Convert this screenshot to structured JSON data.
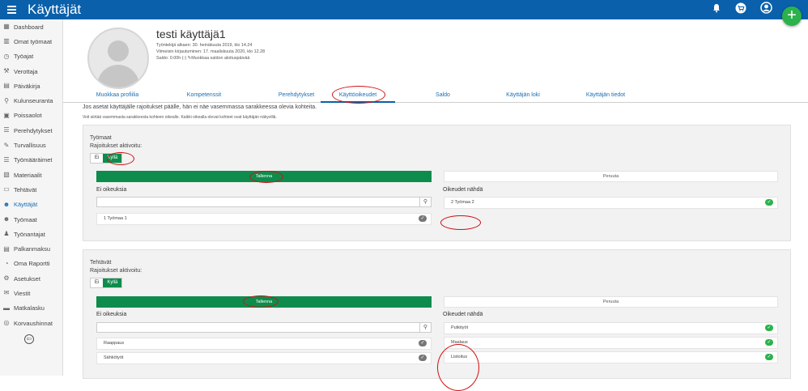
{
  "header": {
    "title": "Käyttäjät"
  },
  "sidebar": {
    "items": [
      {
        "label": "Dashboard",
        "icon": "dashboard-icon",
        "glyph": "▦"
      },
      {
        "label": "Omat työmaat",
        "icon": "building-icon",
        "glyph": "▥"
      },
      {
        "label": "Työajat",
        "icon": "clock-icon",
        "glyph": "◷"
      },
      {
        "label": "Verottaja",
        "icon": "hammer-icon",
        "glyph": "⚒"
      },
      {
        "label": "Päiväkirja",
        "icon": "book-icon",
        "glyph": "▤"
      },
      {
        "label": "Kulunseuranta",
        "icon": "location-icon",
        "glyph": "⚲"
      },
      {
        "label": "Poissaolot",
        "icon": "calendar-icon",
        "glyph": "▣"
      },
      {
        "label": "Perehdytykset",
        "icon": "list-icon",
        "glyph": "☰"
      },
      {
        "label": "Turvallisuus",
        "icon": "pencil-icon",
        "glyph": "✎"
      },
      {
        "label": "Työmääräimet",
        "icon": "list-icon",
        "glyph": "☰"
      },
      {
        "label": "Materiaalit",
        "icon": "box-icon",
        "glyph": "▧"
      },
      {
        "label": "Tehtävät",
        "icon": "document-icon",
        "glyph": "▭"
      },
      {
        "label": "Käyttäjät",
        "icon": "users-icon",
        "glyph": "☻"
      },
      {
        "label": "Työmaat",
        "icon": "user-group-icon",
        "glyph": "☻"
      },
      {
        "label": "Työnantajat",
        "icon": "person-icon",
        "glyph": "♟"
      },
      {
        "label": "Palkanmaksu",
        "icon": "sheet-icon",
        "glyph": "▤"
      },
      {
        "label": "Oma Raportti",
        "icon": "pie-chart-icon",
        "glyph": "◔"
      },
      {
        "label": "Asetukset",
        "icon": "gear-icon",
        "glyph": "⚙"
      },
      {
        "label": "Viestit",
        "icon": "mail-icon",
        "glyph": "✉"
      },
      {
        "label": "Matkalasku",
        "icon": "car-icon",
        "glyph": "▬"
      },
      {
        "label": "Korvaushinnat",
        "icon": "coins-icon",
        "glyph": "◎"
      }
    ],
    "collapse_glyph": "⇦"
  },
  "profile": {
    "name": "testi käyttäjä1",
    "worker_since": "Työntekijä alkaen: 30. heinäkuuta 2019, klo 14.24",
    "last_login": "Viimeisin kirjautuminen: 17. maaliskuuta 2020, klo 12.28",
    "balance": "Saldo: 0.00h (-)",
    "edit_balance": "Muokkaa saldon aloituspäivää"
  },
  "tabs": [
    {
      "label": "Muokkaa profiilia",
      "name": "tab-edit-profile"
    },
    {
      "label": "Kompetenssit",
      "name": "tab-competences"
    },
    {
      "label": "Perehdytykset",
      "name": "tab-orientations"
    },
    {
      "label": "Käyttöoikeudet",
      "name": "tab-permissions"
    },
    {
      "label": "Saldo",
      "name": "tab-balance"
    },
    {
      "label": "Käyttäjän loki",
      "name": "tab-user-log"
    },
    {
      "label": "Käyttäjän tiedot",
      "name": "tab-user-info"
    }
  ],
  "info": {
    "line1": "Jos asetat käyttäjälle rajoitukset päälle, hän ei näe vasemmassa sarakkeessa olevia kohteita.",
    "line2": "Voit siirtää vasemmasta sarakkeesta kohteen oikealle. Kaikki oikealla olevat kohteet ovat käyttäjän näkyvillä."
  },
  "sections": [
    {
      "title": "Työmaat",
      "restrictions_label": "Rajoitukset aktivoitu:",
      "toggle_off": "Ei",
      "toggle_on": "Kyllä",
      "save_label": "Tallenna",
      "cancel_label": "Peruuta",
      "left_header": "Ei oikeuksia",
      "right_header": "Oikeudet nähdä",
      "left_items": [
        "1 Työmaa 1"
      ],
      "right_items": [
        "2 Työmaa 2"
      ]
    },
    {
      "title": "Tehtävät",
      "restrictions_label": "Rajoitukset aktivoitu:",
      "toggle_off": "Ei",
      "toggle_on": "Kyllä",
      "save_label": "Tallenna",
      "cancel_label": "Peruuta",
      "left_header": "Ei oikeuksia",
      "right_header": "Oikeudet nähdä",
      "left_items": [
        "Raappaus",
        "Sähkötyöt"
      ],
      "right_items": [
        "Putkityöt",
        "Maalaus",
        "Listoitus"
      ]
    }
  ],
  "glyphs": {
    "search": "⚲",
    "check": "✓",
    "pencil": "✎"
  },
  "colors": {
    "header": "#0a60aa",
    "accent_green": "#0e8c4d",
    "annotation_red": "#d01010"
  }
}
